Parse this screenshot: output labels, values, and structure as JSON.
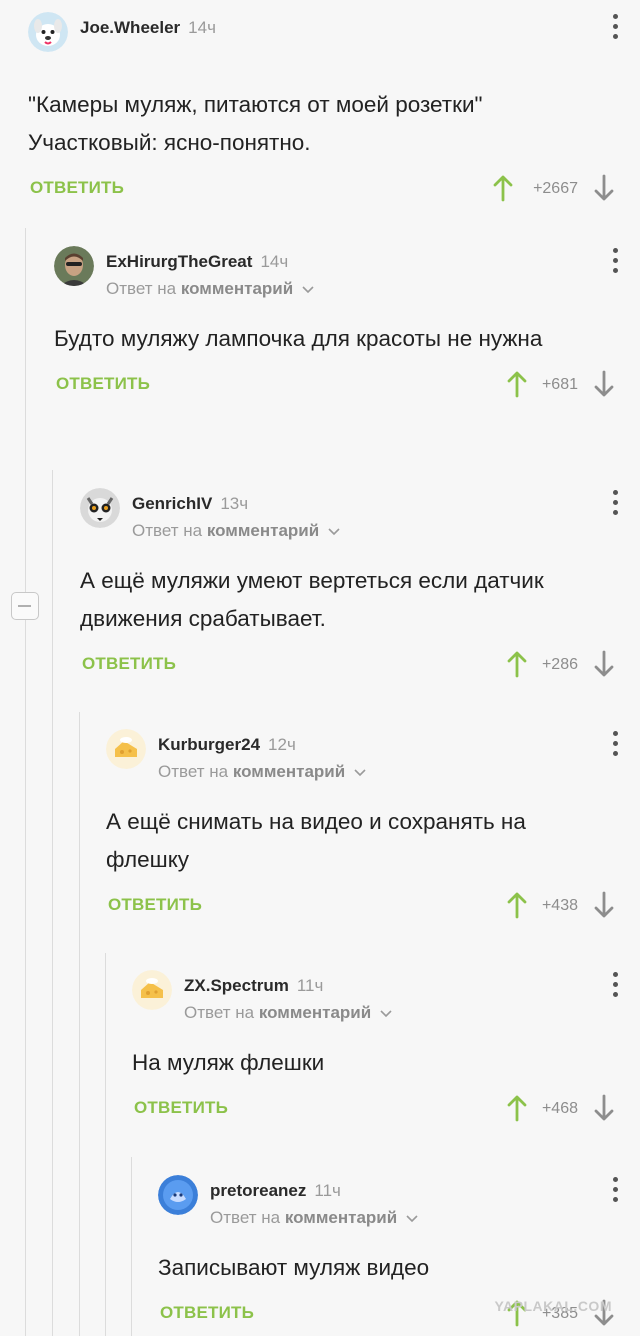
{
  "reply_prefix": "Ответ на",
  "reply_target": "комментарий",
  "reply_button": "ОТВЕТИТЬ",
  "colors": {
    "accent": "#8cc24a",
    "muted": "#9a9a9a",
    "text": "#222222",
    "background": "#f7f7f7"
  },
  "comments": [
    {
      "author": "Joe.Wheeler",
      "time": "14ч",
      "show_reply_to": false,
      "text": "\"Камеры муляж, питаются от моей розетки\" Участковый: ясно-понятно.",
      "rating": "+2667",
      "avatar_icon": "dog-avatar-icon"
    },
    {
      "author": "ExHirurgTheGreat",
      "time": "14ч",
      "show_reply_to": true,
      "text": "Будто муляжу лампочка для красоты не нужна",
      "rating": "+681",
      "avatar_icon": "man-portrait-avatar-icon"
    },
    {
      "author": "GenrichIV",
      "time": "13ч",
      "show_reply_to": true,
      "text": "А ещё муляжи умеют вертеться если датчик движения срабатывает.",
      "rating": "+286",
      "avatar_icon": "lemur-avatar-icon"
    },
    {
      "author": "Kurburger24",
      "time": "12ч",
      "show_reply_to": true,
      "text": "А ещё снимать на видео и сохранять на флешку",
      "rating": "+438",
      "avatar_icon": "cheese-avatar-icon"
    },
    {
      "author": "ZX.Spectrum",
      "time": "11ч",
      "show_reply_to": true,
      "text": "На муляж флешки",
      "rating": "+468",
      "avatar_icon": "cheese-avatar-icon"
    },
    {
      "author": "pretoreanez",
      "time": "11ч",
      "show_reply_to": true,
      "text": "Записывают муляж видео",
      "rating": "+385",
      "avatar_icon": "blue-badge-avatar-icon"
    }
  ],
  "watermark": "YAPLAKAL.COM"
}
